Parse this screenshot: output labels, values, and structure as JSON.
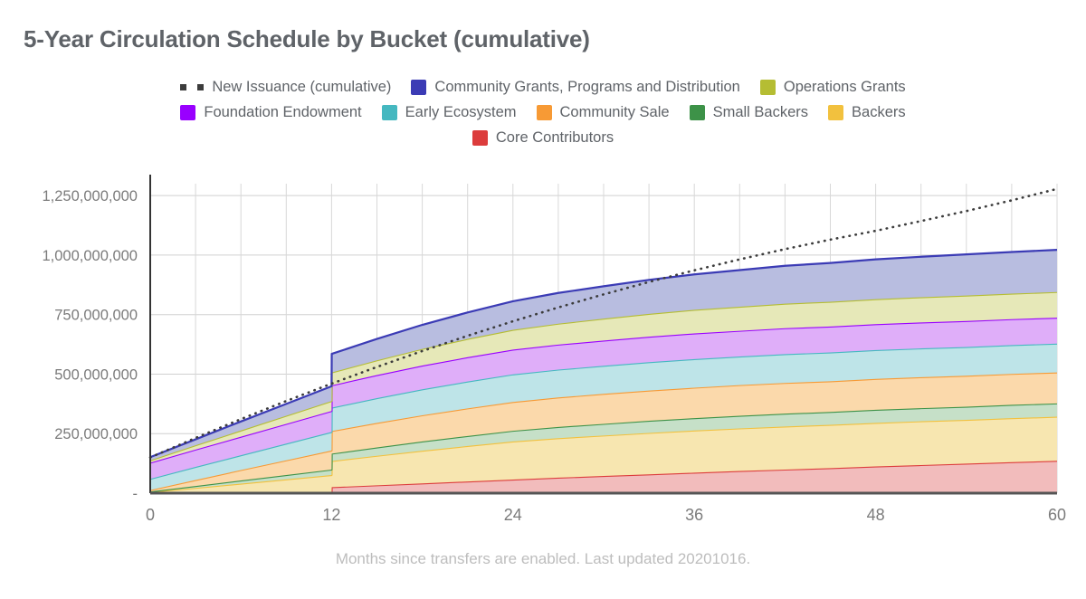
{
  "header": {
    "title": "5-Year Circulation Schedule by Bucket (cumulative)"
  },
  "footer": {
    "note": "Months since transfers are enabled. Last updated 20201016."
  },
  "legend": {
    "rows": [
      [
        {
          "label": "New Issuance (cumulative)",
          "color": "#3c3c3c",
          "marker": "dotted"
        },
        {
          "label": "Community Grants, Programs and Distribution",
          "color": "#3b3bb5",
          "marker": "square"
        },
        {
          "label": "Operations Grants",
          "color": "#b5bd33",
          "marker": "square"
        }
      ],
      [
        {
          "label": "Foundation Endowment",
          "color": "#9900ff",
          "marker": "square"
        },
        {
          "label": "Early Ecosystem",
          "color": "#45b8c0",
          "marker": "square"
        },
        {
          "label": "Community Sale",
          "color": "#f79a35",
          "marker": "square"
        },
        {
          "label": "Small Backers",
          "color": "#3d9248",
          "marker": "square"
        },
        {
          "label": "Backers",
          "color": "#f2c13e",
          "marker": "square"
        }
      ],
      [
        {
          "label": "Core Contributors",
          "color": "#dc3c3c",
          "marker": "square"
        }
      ]
    ]
  },
  "chart_data": {
    "type": "area",
    "title": "5-Year Circulation Schedule by Bucket (cumulative)",
    "subtitle": "Months since transfers are enabled. Last updated 20201016.",
    "stacked": true,
    "xlabel": "Months since transfers are enabled",
    "ylabel": "",
    "xlim": [
      0,
      60
    ],
    "ylim": [
      0,
      1300000000
    ],
    "grid": true,
    "legend_position": "top",
    "x_ticks": [
      "0",
      "12",
      "24",
      "36",
      "48",
      "60"
    ],
    "x_tick_values": [
      0,
      12,
      24,
      36,
      48,
      60
    ],
    "y_ticks": [
      "-",
      "250,000,000",
      "500,000,000",
      "750,000,000",
      "1,000,000,000",
      "1,250,000,000"
    ],
    "y_tick_values": [
      0,
      250000000,
      500000000,
      750000000,
      1000000000,
      1250000000
    ],
    "x": [
      0,
      3,
      6,
      9,
      12,
      12.01,
      15,
      18,
      21,
      24,
      27,
      30,
      33,
      36,
      39,
      42,
      45,
      48,
      51,
      54,
      57,
      60
    ],
    "series": [
      {
        "name": "Core Contributors",
        "color": "#dc3c3c",
        "fill": "#f2bcbc",
        "stack_order": 1,
        "values": [
          0,
          0,
          0,
          0,
          0,
          25000000,
          33000000,
          41000000,
          49000000,
          57000000,
          65000000,
          72000000,
          79000000,
          86000000,
          93000000,
          99000000,
          105000000,
          112000000,
          118000000,
          124000000,
          130000000,
          136000000
        ]
      },
      {
        "name": "Backers",
        "color": "#f2c13e",
        "fill": "#f7e6b0",
        "stack_order": 2,
        "values": [
          5000000,
          22000000,
          40000000,
          58000000,
          76000000,
          110000000,
          124000000,
          137000000,
          149000000,
          160000000,
          166000000,
          170000000,
          174000000,
          177000000,
          179000000,
          181000000,
          182000000,
          183000000,
          184000000,
          184000000,
          185000000,
          185000000
        ]
      },
      {
        "name": "Small Backers",
        "color": "#3d9248",
        "fill": "#c6e0c8",
        "stack_order": 3,
        "values": [
          2000000,
          8000000,
          13000000,
          18000000,
          23000000,
          31000000,
          35000000,
          39000000,
          42000000,
          45000000,
          47000000,
          49000000,
          51000000,
          52000000,
          53000000,
          54000000,
          54000000,
          55000000,
          55000000,
          55000000,
          56000000,
          56000000
        ]
      },
      {
        "name": "Community Sale",
        "color": "#f79a35",
        "fill": "#fbd9ab",
        "stack_order": 4,
        "values": [
          6000000,
          25000000,
          44000000,
          62000000,
          80000000,
          95000000,
          103000000,
          110000000,
          116000000,
          121000000,
          124000000,
          126000000,
          127000000,
          128000000,
          129000000,
          129000000,
          129000000,
          130000000,
          130000000,
          130000000,
          130000000,
          130000000
        ]
      },
      {
        "name": "Early Ecosystem",
        "color": "#45b8c0",
        "fill": "#bee4e8",
        "stack_order": 5,
        "values": [
          47000000,
          55000000,
          62000000,
          70000000,
          78000000,
          98000000,
          104000000,
          109000000,
          113000000,
          116000000,
          117000000,
          118000000,
          119000000,
          120000000,
          120000000,
          121000000,
          121000000,
          121000000,
          121000000,
          121000000,
          121000000,
          121000000
        ]
      },
      {
        "name": "Foundation Endowment",
        "color": "#9900ff",
        "fill": "#dfaef9",
        "stack_order": 6,
        "values": [
          68000000,
          73000000,
          78000000,
          83000000,
          88000000,
          94000000,
          97000000,
          100000000,
          102000000,
          104000000,
          105000000,
          106000000,
          107000000,
          108000000,
          108000000,
          109000000,
          109000000,
          109000000,
          109000000,
          109000000,
          109000000,
          109000000
        ]
      },
      {
        "name": "Operations Grants",
        "color": "#b5bd33",
        "fill": "#e6e8b8",
        "stack_order": 7,
        "values": [
          10000000,
          18000000,
          26000000,
          34000000,
          42000000,
          54000000,
          62000000,
          70000000,
          77000000,
          83000000,
          88000000,
          92000000,
          96000000,
          99000000,
          101000000,
          103000000,
          104000000,
          105000000,
          106000000,
          107000000,
          107000000,
          108000000
        ]
      },
      {
        "name": "Community Grants, Programs and Distribution",
        "color": "#3b3bb5",
        "fill": "#b8bde0",
        "stack_order": 8,
        "values": [
          13000000,
          25000000,
          38000000,
          50000000,
          62000000,
          78000000,
          90000000,
          101000000,
          111000000,
          120000000,
          129000000,
          136000000,
          143000000,
          149000000,
          154000000,
          159000000,
          163000000,
          167000000,
          170000000,
          173000000,
          175000000,
          177000000
        ]
      }
    ],
    "reference_line": {
      "name": "New Issuance (cumulative)",
      "color": "#3c3c3c",
      "style": "dotted",
      "x": [
        0,
        3,
        6,
        9,
        12,
        15,
        18,
        21,
        24,
        27,
        30,
        33,
        36,
        39,
        42,
        45,
        48,
        51,
        54,
        57,
        60
      ],
      "values": [
        150000000,
        232000000,
        311000000,
        387000000,
        460000000,
        530000000,
        597000000,
        661000000,
        722000000,
        780000000,
        835000000,
        887000000,
        936000000,
        982000000,
        1025000000,
        1065000000,
        1102000000,
        1143000000,
        1185000000,
        1230000000,
        1278000000
      ]
    },
    "stack_totals_note": "Areas are stacked cumulatively; top of stack reaches ~1,022,000,000 at month 60."
  }
}
